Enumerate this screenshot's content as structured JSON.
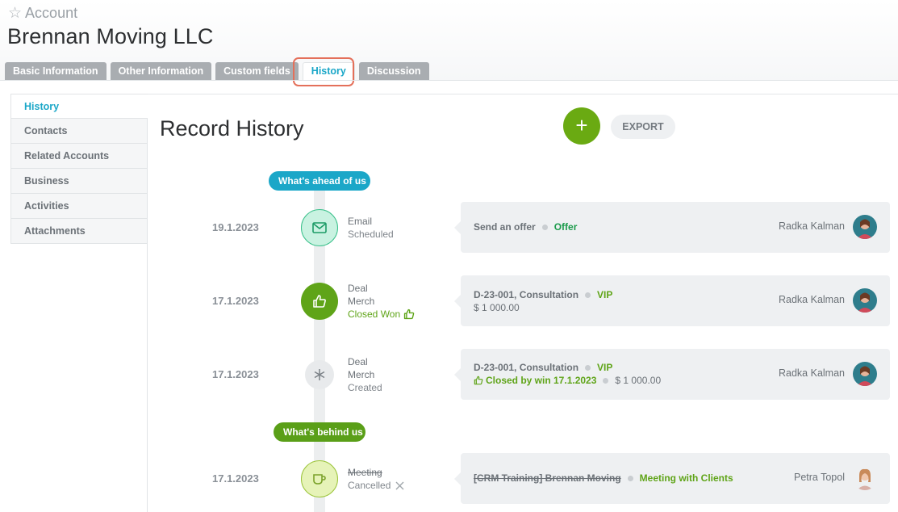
{
  "header": {
    "breadcrumb": "Account",
    "title": "Brennan Moving LLC"
  },
  "tabs": [
    {
      "label": "Basic Information"
    },
    {
      "label": "Other Information"
    },
    {
      "label": "Custom fields"
    },
    {
      "label": "History"
    },
    {
      "label": "Discussion"
    }
  ],
  "sidebar": {
    "items": [
      {
        "label": "History"
      },
      {
        "label": "Contacts"
      },
      {
        "label": "Related Accounts"
      },
      {
        "label": "Business"
      },
      {
        "label": "Activities"
      },
      {
        "label": "Attachments"
      }
    ]
  },
  "main": {
    "title": "Record History",
    "add_label": "+",
    "export_label": "EXPORT",
    "ahead_label": "What's ahead of us",
    "behind_label": "What's behind us",
    "entries": [
      {
        "date": "19.1.2023",
        "icon": "envelope-icon",
        "type": "Email",
        "status": "Scheduled",
        "card_title": "Send an offer",
        "card_tag": "Offer",
        "person": "Radka Kalman"
      },
      {
        "date": "17.1.2023",
        "icon": "thumbs-up-icon",
        "type": "Deal",
        "sub": "Merch",
        "status": "Closed Won",
        "card_title": "D-23-001, Consultation",
        "card_tag": "VIP",
        "card_amount": "$ 1 000.00",
        "person": "Radka Kalman"
      },
      {
        "date": "17.1.2023",
        "icon": "asterisk-icon",
        "type": "Deal",
        "sub": "Merch",
        "status": "Created",
        "card_title": "D-23-001, Consultation",
        "card_tag": "VIP",
        "card_closed": "Closed by win 17.1.2023",
        "card_amount": "$ 1 000.00",
        "person": "Radka Kalman"
      },
      {
        "date": "17.1.2023",
        "icon": "coffee-cup-icon",
        "type": "Meeting",
        "status": "Cancelled",
        "card_title": "[CRM Training] Brennan Moving",
        "card_tag": "Meeting with Clients",
        "person": "Petra Topol"
      }
    ]
  },
  "colors": {
    "accent": "#1ba7c8",
    "green": "#5fa418",
    "highlight": "#e4705a"
  }
}
